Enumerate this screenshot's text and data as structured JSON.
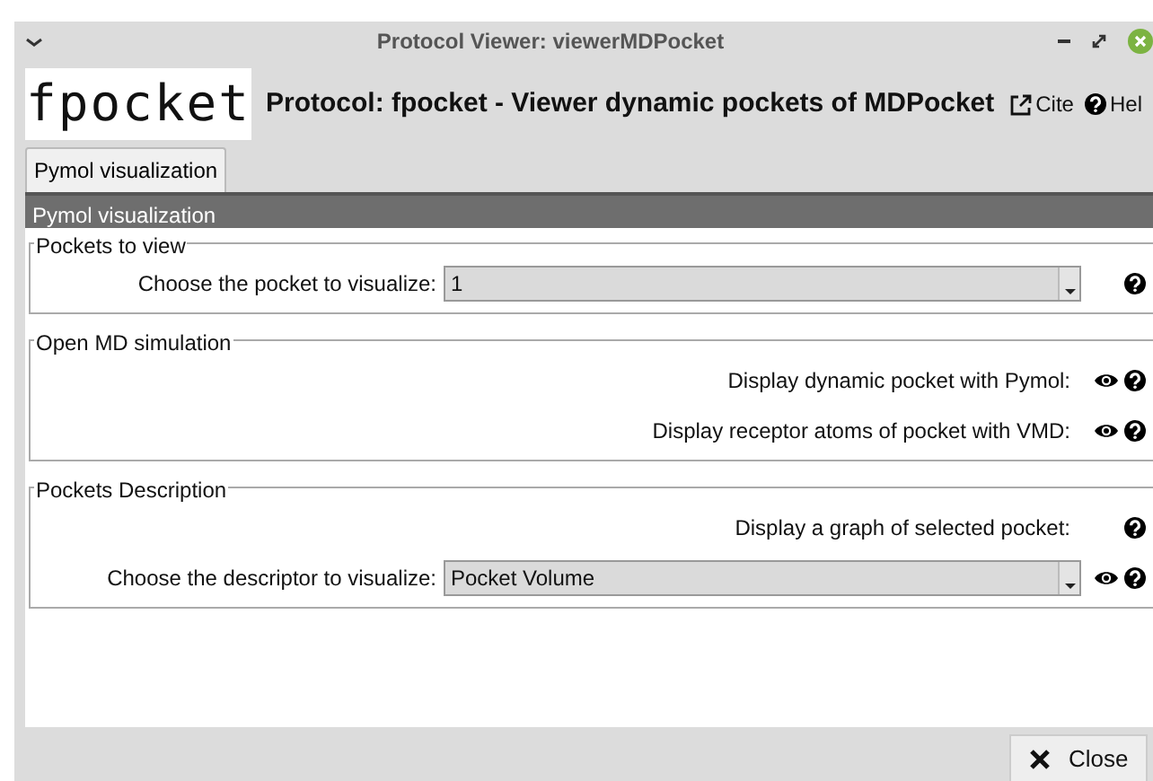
{
  "window": {
    "title": "Protocol Viewer: viewerMDPocket"
  },
  "header": {
    "logo": "fpocket",
    "title": "Protocol: fpocket - Viewer dynamic pockets of MDPocket",
    "links": [
      {
        "kind": "cite",
        "label": "Cite"
      },
      {
        "kind": "help",
        "label": "Hel"
      }
    ]
  },
  "tabs": [
    {
      "label": "Pymol visualization"
    }
  ],
  "section": {
    "title": "Pymol visualization"
  },
  "groups": [
    {
      "title": "Pockets to view",
      "rows": [
        {
          "kind": "combo",
          "label": "Choose the pocket to visualize:",
          "value": "1",
          "icons": [
            {
              "kind": "help"
            }
          ]
        }
      ]
    },
    {
      "title": "Open MD simulation",
      "rows": [
        {
          "kind": "action",
          "label": "Display dynamic pocket with Pymol:",
          "icons": [
            {
              "kind": "view"
            },
            {
              "kind": "help"
            }
          ]
        },
        {
          "kind": "action",
          "label": "Display receptor atoms of pocket with VMD:",
          "icons": [
            {
              "kind": "view"
            },
            {
              "kind": "help"
            }
          ]
        }
      ]
    },
    {
      "title": "Pockets Description",
      "rows": [
        {
          "kind": "action",
          "label": "Display a graph of selected pocket:",
          "icons": [
            {
              "kind": "help"
            }
          ]
        },
        {
          "kind": "combo",
          "label": "Choose the descriptor to visualize:",
          "value": "Pocket Volume",
          "icons": [
            {
              "kind": "view"
            },
            {
              "kind": "help"
            }
          ]
        }
      ]
    }
  ],
  "buttons": [
    {
      "label": "Close"
    }
  ]
}
